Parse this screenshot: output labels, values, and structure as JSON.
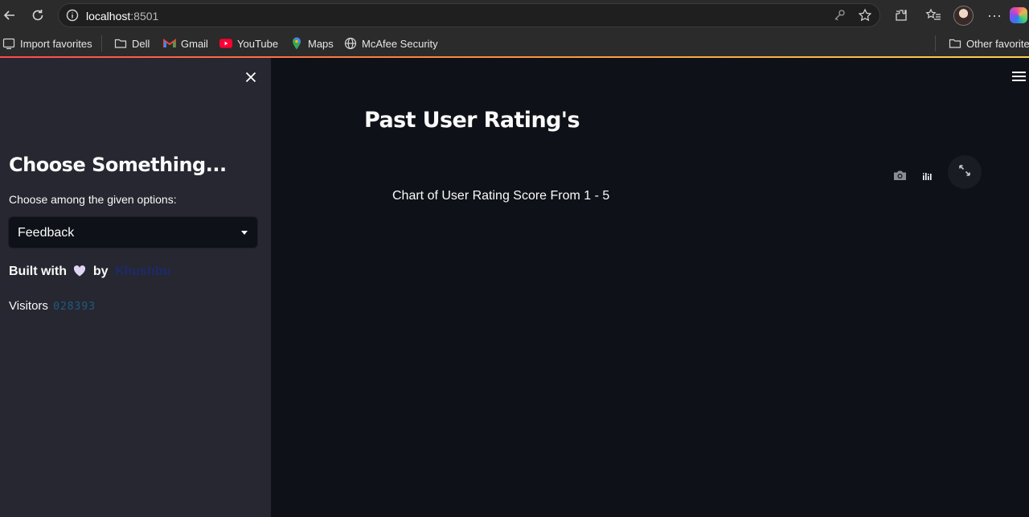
{
  "browser": {
    "url_host": "localhost",
    "url_port": ":8501",
    "bookmarks": [
      {
        "label": "Import favorites",
        "icon": "import-icon"
      },
      {
        "label": "Dell",
        "icon": "folder-icon"
      },
      {
        "label": "Gmail",
        "icon": "gmail-icon"
      },
      {
        "label": "YouTube",
        "icon": "youtube-icon"
      },
      {
        "label": "Maps",
        "icon": "maps-pin-icon"
      },
      {
        "label": "McAfee Security",
        "icon": "globe-icon"
      }
    ],
    "other_favorites": "Other favorites",
    "accent_colors": [
      "#ff4b4b",
      "#ff8a3d",
      "#ffd34b"
    ]
  },
  "sidebar": {
    "title": "Choose Something...",
    "select_label": "Choose among the given options:",
    "select_value": "Feedback",
    "built_with_prefix": "Built with",
    "built_with_by": "by",
    "author": "Khushbu",
    "visitors_label": "Visitors",
    "visitors_count": "028393",
    "close_icon": "close-icon"
  },
  "main": {
    "page_title": "Past User Rating's",
    "chart_title": "Chart of User Rating Score From 1 - 5",
    "menu_icon": "hamburger-menu-icon"
  },
  "theme": {
    "background": "#0e1117",
    "sidebar_background": "#262730",
    "text": "#fafafa"
  }
}
